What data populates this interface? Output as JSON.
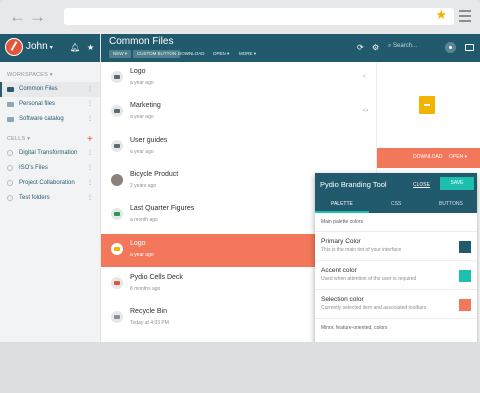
{
  "browser": {
    "back": "←",
    "forward": "→"
  },
  "user": {
    "name": "John"
  },
  "sidebar": {
    "workspaces_label": "WORKSPACES",
    "workspaces": [
      {
        "label": "Common Files",
        "active": true
      },
      {
        "label": "Personal files",
        "active": false
      },
      {
        "label": "Software catalog",
        "active": false
      }
    ],
    "cells_label": "CELLS",
    "cells": [
      {
        "label": "Digital Transformation"
      },
      {
        "label": "ISO's Files"
      },
      {
        "label": "Project Collaboration"
      },
      {
        "label": "Test folders"
      }
    ]
  },
  "toolbar": {
    "title": "Common Files",
    "new": "NEW ▾",
    "custom": "CUSTOM BUTTON",
    "download": "DOWNLOAD",
    "open": "OPEN ▾",
    "more": "MORE ▾",
    "search_placeholder": "Search..."
  },
  "files": [
    {
      "name": "Logo",
      "meta": "a year ago",
      "icon": "folder"
    },
    {
      "name": "Marketing",
      "meta": "a year ago",
      "icon": "folder"
    },
    {
      "name": "User guides",
      "meta": "a year ago",
      "icon": "folder"
    },
    {
      "name": "Bicycle Product",
      "meta": "2 years ago",
      "icon": "image"
    },
    {
      "name": "Last Quarter Figures",
      "meta": "a month ago",
      "icon": "spreadsheet"
    },
    {
      "name": "Logo",
      "meta": "a year ago",
      "icon": "archive",
      "selected": true
    },
    {
      "name": "Pydio Cells Deck",
      "meta": "8 months ago",
      "icon": "pdf"
    },
    {
      "name": "Recycle Bin",
      "meta": "Today at 4:03 PM",
      "icon": "trash"
    }
  ],
  "preview": {
    "download": "DOWNLOAD",
    "open": "OPEN ▾"
  },
  "branding": {
    "title": "Pydio Branding Tool",
    "close": "CLOSE",
    "save": "SAVE",
    "tabs": [
      "PALETTE",
      "CSS",
      "BUTTONS"
    ],
    "main_label": "Main palette colors",
    "colors": [
      {
        "title": "Primary Color",
        "desc": "This is the main tint of your interface",
        "color": "#215a6c"
      },
      {
        "title": "Accent color",
        "desc": "Used when attention of the user is required",
        "color": "#1dbfaf"
      },
      {
        "title": "Selection color",
        "desc": "Currently selected item and associated toolbars",
        "color": "#f2775b"
      }
    ],
    "minor_label": "Minor, feature-oriented, colors"
  }
}
